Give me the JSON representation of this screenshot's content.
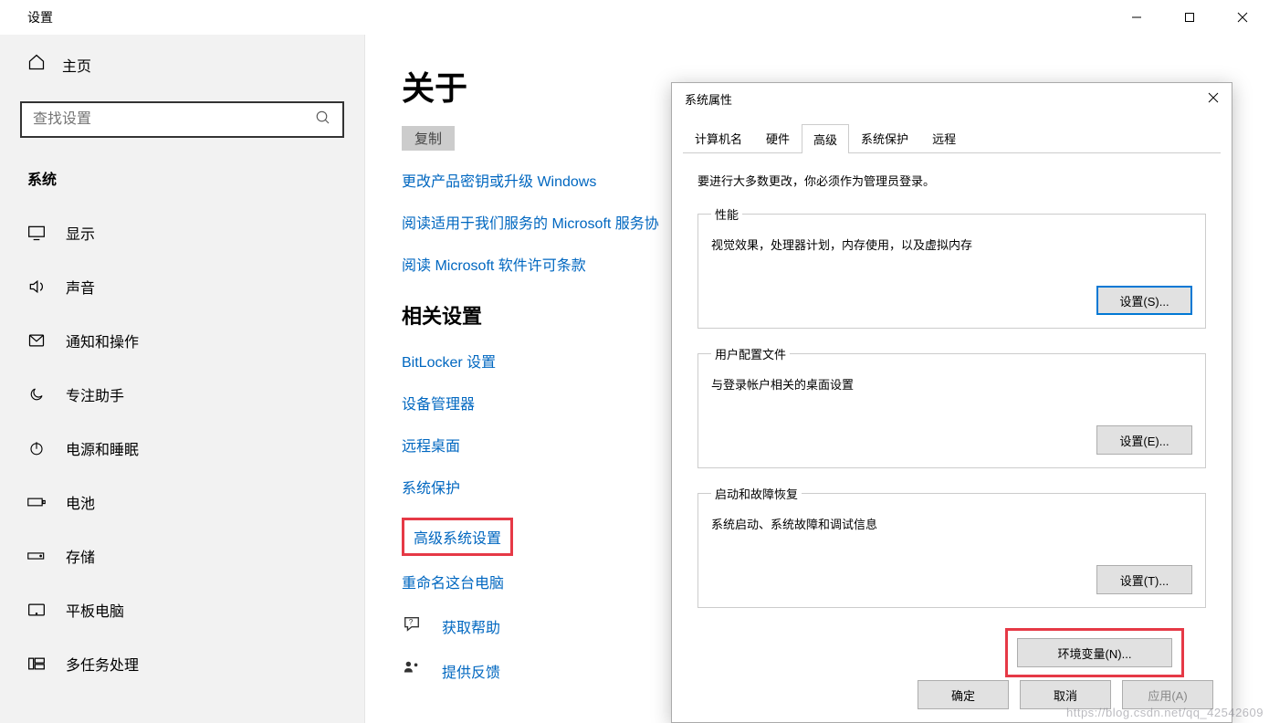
{
  "settings": {
    "title": "设置",
    "home": "主页",
    "search_placeholder": "查找设置",
    "section": "系统",
    "items": [
      {
        "label": "显示"
      },
      {
        "label": "声音"
      },
      {
        "label": "通知和操作"
      },
      {
        "label": "专注助手"
      },
      {
        "label": "电源和睡眠"
      },
      {
        "label": "电池"
      },
      {
        "label": "存储"
      },
      {
        "label": "平板电脑"
      },
      {
        "label": "多任务处理"
      }
    ]
  },
  "main": {
    "heading": "关于",
    "copy": "复制",
    "links_top": [
      "更改产品密钥或升级 Windows",
      "阅读适用于我们服务的 Microsoft 服务协",
      "阅读 Microsoft 软件许可条款"
    ],
    "related_title": "相关设置",
    "related_links": [
      "BitLocker 设置",
      "设备管理器",
      "远程桌面",
      "系统保护",
      "高级系统设置",
      "重命名这台电脑"
    ],
    "help": "获取帮助",
    "feedback": "提供反馈"
  },
  "dialog": {
    "title": "系统属性",
    "tabs": [
      "计算机名",
      "硬件",
      "高级",
      "系统保护",
      "远程"
    ],
    "active_tab": 2,
    "admin_note": "要进行大多数更改，你必须作为管理员登录。",
    "perf": {
      "legend": "性能",
      "desc": "视觉效果，处理器计划，内存使用，以及虚拟内存",
      "btn": "设置(S)..."
    },
    "profile": {
      "legend": "用户配置文件",
      "desc": "与登录帐户相关的桌面设置",
      "btn": "设置(E)..."
    },
    "startup": {
      "legend": "启动和故障恢复",
      "desc": "系统启动、系统故障和调试信息",
      "btn": "设置(T)..."
    },
    "env_btn": "环境变量(N)...",
    "ok": "确定",
    "cancel": "取消",
    "apply": "应用(A)"
  },
  "watermark": "https://blog.csdn.net/qq_42542609"
}
